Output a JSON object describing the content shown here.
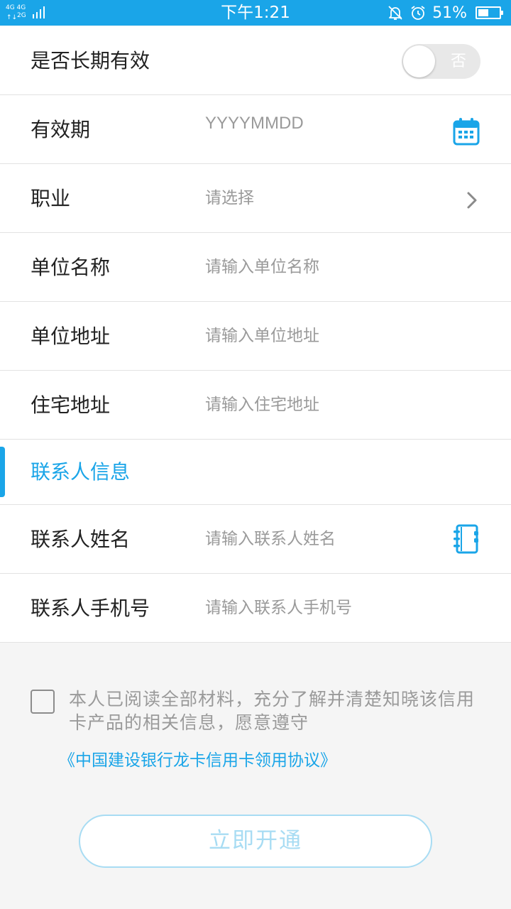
{
  "status_bar": {
    "net_top": "4G 4G",
    "net_bottom": "2G",
    "time": "下午1:21",
    "battery_percent_text": "51%",
    "battery_level": 0.51,
    "icons": [
      "signal-icon",
      "mute-bell-icon",
      "alarm-clock-icon",
      "battery-icon"
    ]
  },
  "form": {
    "long_term_valid": {
      "label": "是否长期有效",
      "toggle_text": "否",
      "on": false
    },
    "expiry": {
      "label": "有效期",
      "placeholder": "YYYYMMDD",
      "icon": "calendar-icon"
    },
    "occupation": {
      "label": "职业",
      "placeholder": "请选择",
      "icon": "chevron-right-icon"
    },
    "company_name": {
      "label": "单位名称",
      "placeholder": "请输入单位名称"
    },
    "company_address": {
      "label": "单位地址",
      "placeholder": "请输入单位地址"
    },
    "home_address": {
      "label": "住宅地址",
      "placeholder": "请输入住宅地址"
    }
  },
  "contact_section": {
    "title": "联系人信息",
    "name": {
      "label": "联系人姓名",
      "placeholder": "请输入联系人姓名",
      "icon": "address-book-icon"
    },
    "phone": {
      "label": "联系人手机号",
      "placeholder": "请输入联系人手机号"
    }
  },
  "agreement": {
    "checked": false,
    "text": "本人已阅读全部材料，充分了解并清楚知晓该信用卡产品的相关信息，愿意遵守",
    "link": "《中国建设银行龙卡信用卡领用协议》"
  },
  "submit_button": "立即开通",
  "colors": {
    "accent": "#1aa5e8",
    "button_disabled": "#a8dcf3",
    "placeholder": "#9a9a9a"
  }
}
